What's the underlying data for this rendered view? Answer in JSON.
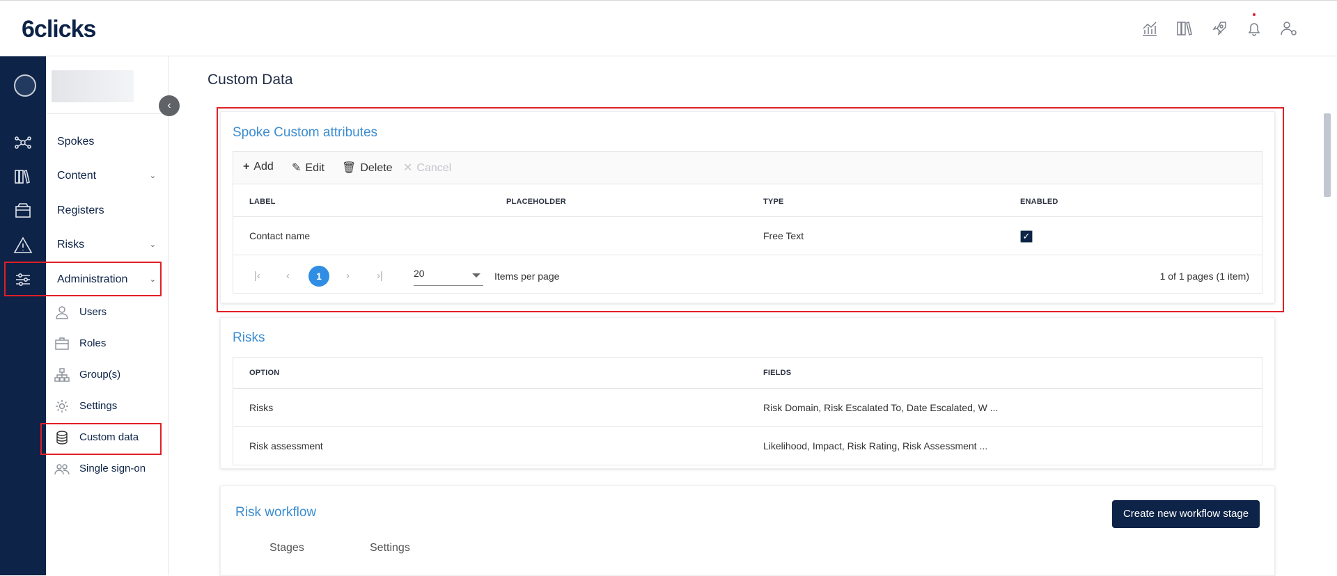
{
  "app": {
    "logo": "6clicks"
  },
  "topbar": {
    "icons": [
      "analytics-icon",
      "library-icon",
      "rocket-icon",
      "bell-icon",
      "user-settings-icon"
    ]
  },
  "sidebar": {
    "items": [
      {
        "label": "Spokes"
      },
      {
        "label": "Content"
      },
      {
        "label": "Registers"
      },
      {
        "label": "Risks"
      },
      {
        "label": "Administration"
      }
    ],
    "sub_items": [
      {
        "label": "Users"
      },
      {
        "label": "Roles"
      },
      {
        "label": "Group(s)"
      },
      {
        "label": "Settings"
      },
      {
        "label": "Custom data"
      },
      {
        "label": "Single sign-on"
      }
    ]
  },
  "page": {
    "title": "Custom Data"
  },
  "spoke_card": {
    "title": "Spoke Custom attributes",
    "toolbar": {
      "add": "Add",
      "edit": "Edit",
      "delete": "Delete",
      "cancel": "Cancel"
    },
    "columns": [
      "LABEL",
      "PLACEHOLDER",
      "TYPE",
      "ENABLED"
    ],
    "rows": [
      {
        "label": "Contact name",
        "placeholder": "",
        "type": "Free Text",
        "enabled": true
      }
    ],
    "pager": {
      "current_page": "1",
      "page_size": "20",
      "items_per_page": "Items per page",
      "summary": "1 of 1 pages (1 item)"
    }
  },
  "risks_card": {
    "title": "Risks",
    "columns": [
      "OPTION",
      "FIELDS"
    ],
    "rows": [
      {
        "option": "Risks",
        "fields": "Risk Domain, Risk Escalated To, Date Escalated, W ..."
      },
      {
        "option": "Risk assessment",
        "fields": "Likelihood, Impact, Risk Rating, Risk Assessment ..."
      }
    ]
  },
  "workflow_card": {
    "title": "Risk workflow",
    "create_button": "Create new workflow stage",
    "tabs": [
      "Stages",
      "Settings"
    ]
  },
  "colors": {
    "brand_navy": "#0d2347",
    "accent_blue": "#3c8dd0",
    "highlight_red": "#e01f26",
    "page_blue": "#2f8de4"
  }
}
